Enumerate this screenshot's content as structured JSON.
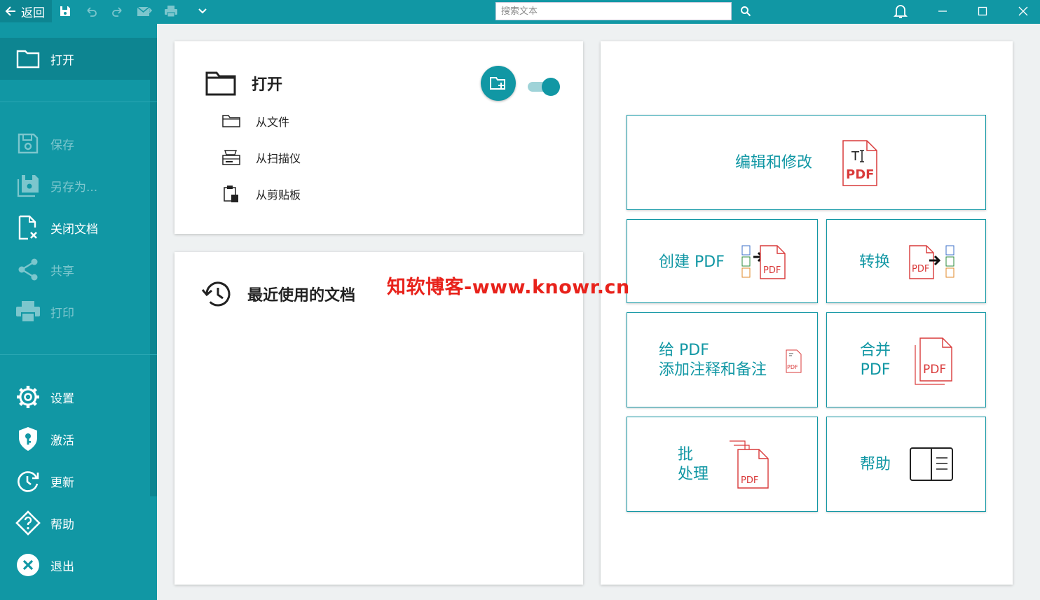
{
  "titlebar": {
    "back_label": "返回",
    "search_placeholder": "搜索文本",
    "icons": [
      "save-icon",
      "undo-icon",
      "redo-icon",
      "email-icon",
      "print-icon",
      "chevron-down-icon",
      "search-icon",
      "bell-icon",
      "minimize-icon",
      "maximize-icon",
      "close-icon"
    ]
  },
  "sidebar": {
    "open": "打开",
    "save": "保存",
    "save_as": "另存为...",
    "close_doc": "关闭文档",
    "share": "共享",
    "print": "打印",
    "settings": "设置",
    "activate": "激活",
    "update": "更新",
    "help": "帮助",
    "exit": "退出"
  },
  "open_panel": {
    "title": "打开",
    "from_file": "从文件",
    "from_scanner": "从扫描仪",
    "from_clipboard": "从剪贴板"
  },
  "recent_panel": {
    "title": "最近使用的文档"
  },
  "tiles": {
    "edit": "编辑和修改",
    "create_pdf": "创建 PDF",
    "convert": "转换",
    "annotate_line1": "给 PDF",
    "annotate_line2": "添加注释和备注",
    "merge_line1": "合并",
    "merge_line2": "PDF",
    "batch_line1": "批",
    "batch_line2": "处理",
    "help": "帮助",
    "pdf_badge": "PDF"
  },
  "watermark": "知软博客-www.knowr.cn",
  "colors": {
    "accent": "#1197a4",
    "accent_dark": "#0d8591",
    "pdf_red": "#d93a3a",
    "watermark": "#e8221b"
  }
}
